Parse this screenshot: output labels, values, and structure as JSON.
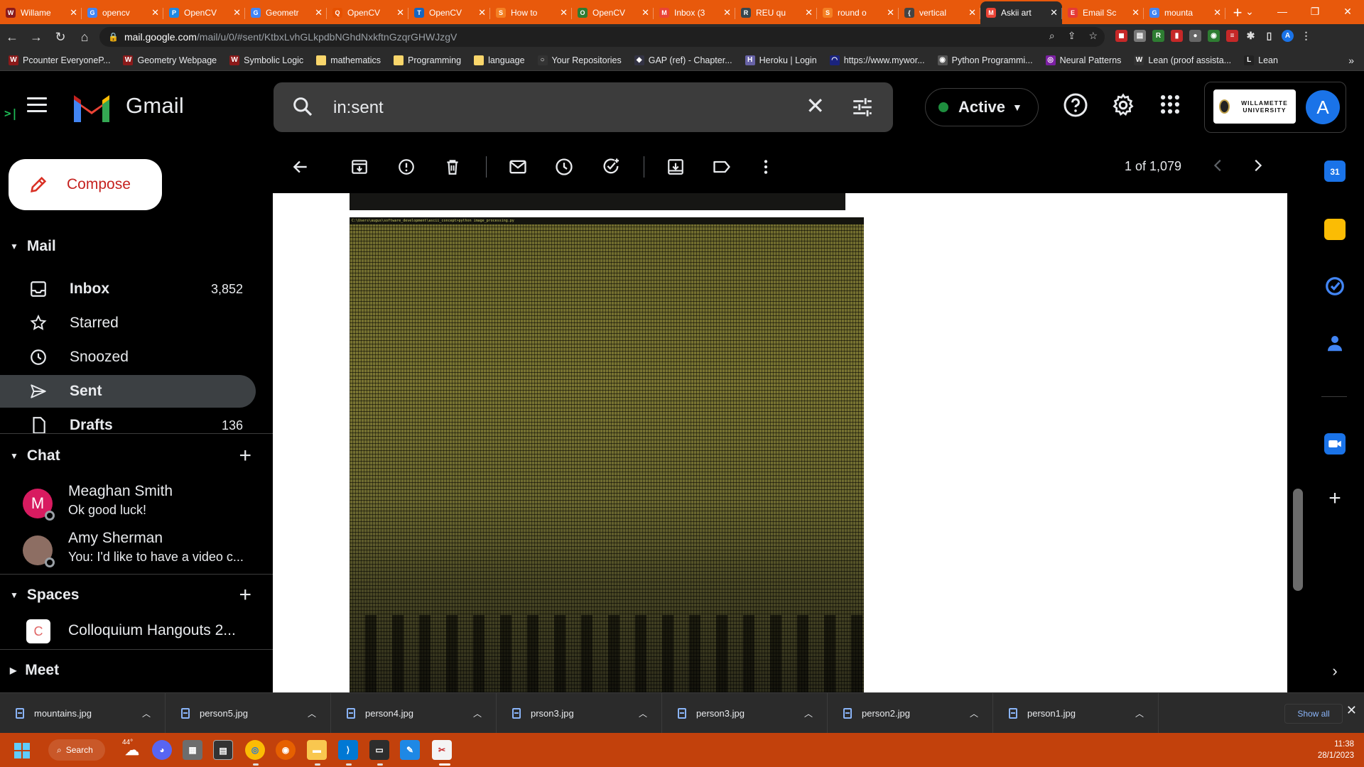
{
  "browser": {
    "tabs": [
      {
        "label": "Willame",
        "icon": "W",
        "color": "#8b1a1a"
      },
      {
        "label": "opencv",
        "icon": "G",
        "color": "#4285f4"
      },
      {
        "label": "OpenCV",
        "icon": "P",
        "color": "#1e88e5"
      },
      {
        "label": "Geometr",
        "icon": "G",
        "color": "#4285f4"
      },
      {
        "label": "OpenCV",
        "icon": "Q",
        "color": "#e65100"
      },
      {
        "label": "OpenCV",
        "icon": "T",
        "color": "#1565c0"
      },
      {
        "label": "How to",
        "icon": "S",
        "color": "#f48024"
      },
      {
        "label": "OpenCV",
        "icon": "O",
        "color": "#2e7d32"
      },
      {
        "label": "Inbox (3",
        "icon": "M",
        "color": "#ea4335"
      },
      {
        "label": "REU qu",
        "icon": "R",
        "color": "#37474f"
      },
      {
        "label": "round o",
        "icon": "S",
        "color": "#f48024"
      },
      {
        "label": "vertical",
        "icon": "{",
        "color": "#444"
      },
      {
        "label": "Askii art",
        "icon": "M",
        "color": "#ea4335"
      },
      {
        "label": "Email Sc",
        "icon": "E",
        "color": "#e53935"
      },
      {
        "label": "mounta",
        "icon": "G",
        "color": "#4285f4"
      }
    ],
    "active_tab": 12,
    "url_host": "mail.google.com",
    "url_path": "/mail/u/0/#sent/KtbxLvhGLkpdbNGhdNxkftnGzqrGHWJzgV",
    "bookmarks": [
      {
        "label": "Pcounter EveryoneP...",
        "icon": "W",
        "color": "#8b1a1a"
      },
      {
        "label": "Geometry Webpage",
        "icon": "W",
        "color": "#8b1a1a"
      },
      {
        "label": "Symbolic Logic",
        "icon": "W",
        "color": "#8b1a1a"
      },
      {
        "label": "mathematics",
        "icon": "",
        "color": "#f9d66b"
      },
      {
        "label": "Programming",
        "icon": "",
        "color": "#f9d66b"
      },
      {
        "label": "language",
        "icon": "",
        "color": "#f9d66b"
      },
      {
        "label": "Your Repositories",
        "icon": "○",
        "color": "#333"
      },
      {
        "label": "GAP (ref) - Chapter...",
        "icon": "◆",
        "color": "#334"
      },
      {
        "label": "Heroku | Login",
        "icon": "H",
        "color": "#6762a6"
      },
      {
        "label": "https://www.mywor...",
        "icon": "◠",
        "color": "#1a237e"
      },
      {
        "label": "Python Programmi...",
        "icon": "◉",
        "color": "#555"
      },
      {
        "label": "Neural Patterns",
        "icon": "◎",
        "color": "#7b1fa2"
      },
      {
        "label": "Lean (proof assista...",
        "icon": "W",
        "color": "#333"
      },
      {
        "label": "Lean",
        "icon": "L",
        "color": "#222"
      }
    ]
  },
  "gmail": {
    "app_name": "Gmail",
    "search_value": "in:sent",
    "status_label": "Active",
    "account_initial": "A",
    "org_name": "WILLAMETTE UNIVERSITY",
    "compose_label": "Compose",
    "mail_section": "Mail",
    "nav": [
      {
        "label": "Inbox",
        "count": "3,852",
        "icon": "inbox-icon"
      },
      {
        "label": "Starred",
        "count": "",
        "icon": "star-icon"
      },
      {
        "label": "Snoozed",
        "count": "",
        "icon": "clock-icon"
      },
      {
        "label": "Sent",
        "count": "",
        "icon": "send-icon"
      },
      {
        "label": "Drafts",
        "count": "136",
        "icon": "draft-icon"
      }
    ],
    "selected_nav": 3,
    "chat_section": "Chat",
    "chats": [
      {
        "name": "Meaghan Smith",
        "message": "Ok good luck!",
        "initial": "M",
        "avatar_color": "#d81b60"
      },
      {
        "name": "Amy Sherman",
        "message": "You: I'd like to have a video c...",
        "initial": "",
        "avatar_color": "#8d6e63"
      }
    ],
    "spaces_section": "Spaces",
    "spaces": [
      {
        "name": "Colloquium Hangouts 2...",
        "initial": "C"
      }
    ],
    "meet_section": "Meet",
    "pager_text": "1 of 1,079",
    "ascii_path": "C:\\Users\\augus\\software_development\\ascii_concept>python image_processing.py"
  },
  "downloads": {
    "items": [
      "mountains.jpg",
      "person5.jpg",
      "person4.jpg",
      "prson3.jpg",
      "person3.jpg",
      "person2.jpg",
      "person1.jpg"
    ],
    "show_all": "Show all"
  },
  "taskbar": {
    "search_label": "Search",
    "weather_temp": "44°",
    "time": "11:38",
    "date": "28/1/2023"
  }
}
